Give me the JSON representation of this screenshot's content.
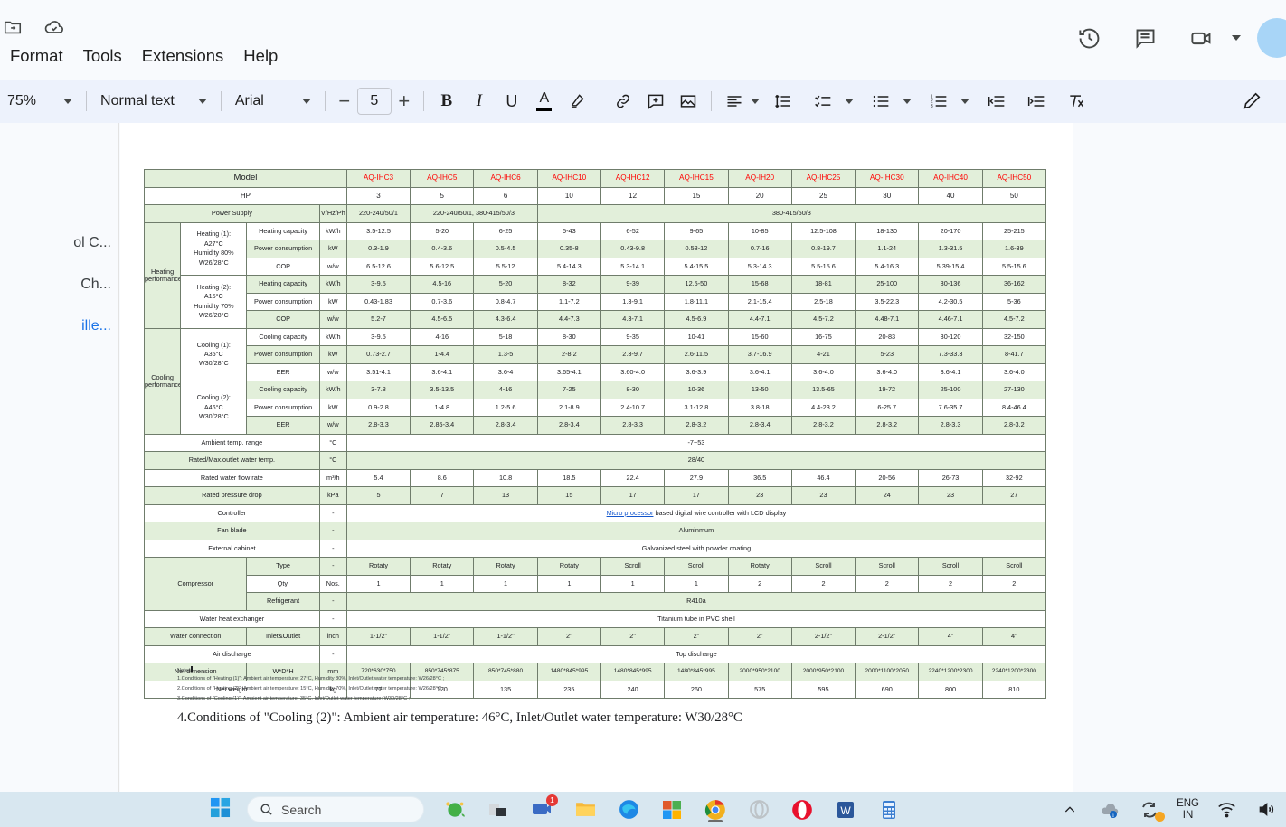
{
  "app": {
    "menus": [
      "Format",
      "Tools",
      "Extensions",
      "Help"
    ],
    "icons": {
      "move_folder": "move-to-folder-icon",
      "cloud_saved": "cloud-saved-icon",
      "history": "version-history-icon",
      "comments": "comments-icon",
      "meet": "google-meet-icon",
      "avatar": "user-avatar"
    }
  },
  "toolbar": {
    "zoom": "75%",
    "style": "Normal text",
    "font": "Arial",
    "font_size": "5",
    "minus": "−",
    "plus": "+",
    "bold": "B",
    "italic": "I",
    "underline": "U",
    "text_color": "A",
    "items": [
      "highlight-pen",
      "link",
      "add-comment",
      "insert-image",
      "align",
      "line-spacing",
      "checklist",
      "bulleted-list",
      "numbered-list",
      "decrease-indent",
      "increase-indent",
      "clear-formatting",
      "editing-mode-pencil"
    ]
  },
  "outline": {
    "items": [
      {
        "label": "ol C...",
        "link": false
      },
      {
        "label": " Ch...",
        "link": false
      },
      {
        "label": "ille...",
        "link": true
      }
    ]
  },
  "taskbar": {
    "search_placeholder": "Search",
    "language": "ENG",
    "region": "IN",
    "chat_badge": "1",
    "icons": [
      "start",
      "search",
      "weather",
      "task-view",
      "chat",
      "file-explorer",
      "edge",
      "store",
      "chrome",
      "opera-gx",
      "opera",
      "word",
      "calculator",
      "show-hidden",
      "onedrive",
      "sync",
      "network",
      "volume"
    ]
  },
  "document": {
    "notes_title": "Notes",
    "notes_small": "1.Conditions of “Heating (1)”: Ambient air temperature: 27°C, Humidity 80%, Inlet/Outlet water temperature: W26/28°C ; 2.Conditions of “Heating (2)”: Ambient air temperature: 15°C, Humidity 70%, Inlet/Outlet water temperature: W26/28°C ; 3.Conditions of “Cooling (1)”: Ambient air temperature: 35°C, Inlet/Outlet water temperature: W30/28°C ;",
    "notes_big": "4.Conditions of \"Cooling (2)\": Ambient air temperature: 46°C, Inlet/Outlet water temperature: W30/28°C"
  },
  "chart_data": {
    "type": "table",
    "title": "Model",
    "models": [
      "AQ-IHC3",
      "AQ-IHC5",
      "AQ-IHC6",
      "AQ-IHC10",
      "AQ-IHC12",
      "AQ-IHC15",
      "AQ-IH20",
      "AQ-IHC25",
      "AQ-IHC30",
      "AQ-IHC40",
      "AQ-IHC50"
    ],
    "hp_label": "HP",
    "hp": [
      "3",
      "5",
      "6",
      "10",
      "12",
      "15",
      "20",
      "25",
      "30",
      "40",
      "50"
    ],
    "power_supply": {
      "label": "Power Supply",
      "unit": "V/Hz/Ph",
      "c1": "220-240/50/1",
      "c2_3": "220-240/50/1, 380-415/50/3",
      "c4_11": "380-415/50/3"
    },
    "heating_perf_label": "Heating performance",
    "cooling_perf_label": "Cooling performance",
    "heating1_cond": [
      "Heating (1):",
      "A27°C",
      "Humidity 80%",
      "W26/28°C"
    ],
    "heating2_cond": [
      "Heating (2):",
      "A15°C",
      "Humidity 70%",
      "W26/28°C"
    ],
    "cooling1_cond": [
      "Cooling (1):",
      "A35°C",
      "W30/28°C"
    ],
    "cooling2_cond": [
      "Cooling (2):",
      "A46°C",
      "W30/28°C"
    ],
    "rows": [
      {
        "label": "Heating capacity",
        "unit": "kW/h",
        "shade": "w",
        "values": [
          "3.5-12.5",
          "5-20",
          "6-25",
          "5-43",
          "6-52",
          "9-65",
          "10-85",
          "12.5-108",
          "18-130",
          "20-170",
          "25-215"
        ]
      },
      {
        "label": "Power consumption",
        "unit": "kW",
        "shade": "g",
        "values": [
          "0.3-1.9",
          "0.4-3.6",
          "0.5-4.5",
          "0.35-8",
          "0.43-9.8",
          "0.58-12",
          "0.7-16",
          "0.8-19.7",
          "1.1-24",
          "1.3-31.5",
          "1.6-39"
        ]
      },
      {
        "label": "COP",
        "unit": "w/w",
        "shade": "w",
        "values": [
          "6.5-12.6",
          "5.6-12.5",
          "5.5-12",
          "5.4-14.3",
          "5.3-14.1",
          "5.4-15.5",
          "5.3-14.3",
          "5.5-15.6",
          "5.4-16.3",
          "5.39-15.4",
          "5.5-15.6"
        ]
      },
      {
        "label": "Heating capacity",
        "unit": "kW/h",
        "shade": "g",
        "values": [
          "3-9.5",
          "4.5-16",
          "5-20",
          "8-32",
          "9-39",
          "12.5-50",
          "15-68",
          "18-81",
          "25-100",
          "30-136",
          "36-162"
        ]
      },
      {
        "label": "Power consumption",
        "unit": "kW",
        "shade": "w",
        "values": [
          "0.43-1.83",
          "0.7-3.6",
          "0.8-4.7",
          "1.1-7.2",
          "1.3-9.1",
          "1.8-11.1",
          "2.1-15.4",
          "2.5-18",
          "3.5-22.3",
          "4.2-30.5",
          "5-36"
        ]
      },
      {
        "label": "COP",
        "unit": "w/w",
        "shade": "g",
        "values": [
          "5.2-7",
          "4.5-6.5",
          "4.3-6.4",
          "4.4-7.3",
          "4.3-7.1",
          "4.5-6.9",
          "4.4-7.1",
          "4.5-7.2",
          "4.48-7.1",
          "4.46-7.1",
          "4.5-7.2"
        ]
      },
      {
        "label": "Cooling capacity",
        "unit": "kW/h",
        "shade": "w",
        "values": [
          "3-9.5",
          "4-16",
          "5-18",
          "8-30",
          "9-35",
          "10-41",
          "15-60",
          "16-75",
          "20-83",
          "30-120",
          "32-150"
        ]
      },
      {
        "label": "Power consumption",
        "unit": "kW",
        "shade": "g",
        "values": [
          "0.73-2.7",
          "1-4.4",
          "1.3-5",
          "2-8.2",
          "2.3-9.7",
          "2.6-11.5",
          "3.7-16.9",
          "4-21",
          "5-23",
          "7.3-33.3",
          "8-41.7"
        ]
      },
      {
        "label": "EER",
        "unit": "w/w",
        "shade": "w",
        "values": [
          "3.51-4.1",
          "3.6-4.1",
          "3.6-4",
          "3.65-4.1",
          "3.60-4.0",
          "3.6-3.9",
          "3.6-4.1",
          "3.6-4.0",
          "3.6-4.0",
          "3.6-4.1",
          "3.6-4.0"
        ]
      },
      {
        "label": "Cooling capacity",
        "unit": "kW/h",
        "shade": "g",
        "values": [
          "3-7.8",
          "3.5-13.5",
          "4-16",
          "7-25",
          "8-30",
          "10-36",
          "13-50",
          "13.5-65",
          "19-72",
          "25-100",
          "27-130"
        ]
      },
      {
        "label": "Power consumption",
        "unit": "kW",
        "shade": "w",
        "values": [
          "0.9-2.8",
          "1-4.8",
          "1.2-5.6",
          "2.1-8.9",
          "2.4-10.7",
          "3.1-12.8",
          "3.8-18",
          "4.4-23.2",
          "6-25.7",
          "7.6-35.7",
          "8.4-46.4"
        ]
      },
      {
        "label": "EER",
        "unit": "w/w",
        "shade": "g",
        "values": [
          "2.8-3.3",
          "2.85-3.4",
          "2.8-3.4",
          "2.8-3.4",
          "2.8-3.3",
          "2.8-3.2",
          "2.8-3.4",
          "2.8-3.2",
          "2.8-3.2",
          "2.8-3.3",
          "2.8-3.2"
        ]
      }
    ],
    "ambient": {
      "label": "Ambient temp. range",
      "unit": "°C",
      "value": "-7~53"
    },
    "outlet_temp": {
      "label": "Rated/Max.outlet water temp.",
      "unit": "°C",
      "value": "28/40"
    },
    "flow_rate": {
      "label": "Rated water flow rate",
      "unit": "m³/h",
      "values": [
        "5.4",
        "8.6",
        "10.8",
        "18.5",
        "22.4",
        "27.9",
        "36.5",
        "46.4",
        "20-56",
        "26-73",
        "32-92"
      ]
    },
    "pressure_drop": {
      "label": "Rated pressure drop",
      "unit": "kPa",
      "values": [
        "5",
        "7",
        "13",
        "15",
        "17",
        "17",
        "23",
        "23",
        "24",
        "23",
        "27"
      ]
    },
    "controller": {
      "label": "Controller",
      "unit": "-",
      "link_text": "Micro processor",
      "value": " based digital wire controller with LCD display"
    },
    "fan_blade": {
      "label": "Fan blade",
      "unit": "-",
      "value": "Aluminmum"
    },
    "cabinet": {
      "label": "External cabinet",
      "unit": "-",
      "value": "Galvanized steel with powder coating"
    },
    "compressor": {
      "label": "Compressor",
      "type_label": "Type",
      "type_unit": "-",
      "types": [
        "Rotaty",
        "Rotaty",
        "Rotaty",
        "Rotaty",
        "Scroll",
        "Scroll",
        "Rotaty",
        "Scroll",
        "Scroll",
        "Scroll",
        "Scroll"
      ],
      "qty_label": "Qty.",
      "qty_unit": "Nos.",
      "qty": [
        "1",
        "1",
        "1",
        "1",
        "1",
        "1",
        "2",
        "2",
        "2",
        "2",
        "2"
      ],
      "refrigerant_label": "Refrigerant",
      "refrigerant_unit": "-",
      "refrigerant": "R410a"
    },
    "heat_exchanger": {
      "label": "Water heat exchanger",
      "unit": "-",
      "value": "Titanium tube in PVC shell"
    },
    "water_connection": {
      "label": "Water connection",
      "sub": "Inlet&Outlet",
      "unit": "inch",
      "values": [
        "1-1/2\"",
        "1-1/2\"",
        "1-1/2\"",
        "2\"",
        "2\"",
        "2\"",
        "2\"",
        "2-1/2\"",
        "2-1/2\"",
        "4\"",
        "4\""
      ]
    },
    "air_discharge": {
      "label": "Air discharge",
      "unit": "-",
      "value": "Top discharge"
    },
    "net_dimension": {
      "label": "Net dimension",
      "sub": "W*D*H",
      "unit": "mm",
      "values": [
        "720*630*750",
        "850*745*875",
        "850*745*880",
        "1480*845*995",
        "1480*845*995",
        "1480*845*995",
        "2000*950*2100",
        "2000*950*2100",
        "2000*1100*2050",
        "2240*1200*2300",
        "2240*1200*2300"
      ]
    },
    "net_weight": {
      "label": "Net weight",
      "unit": "kg",
      "values": [
        "72",
        "120",
        "135",
        "235",
        "240",
        "260",
        "575",
        "595",
        "690",
        "800",
        "810"
      ]
    }
  }
}
